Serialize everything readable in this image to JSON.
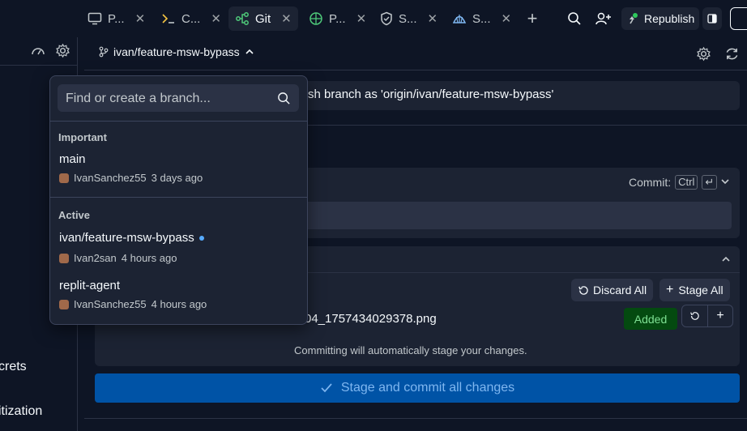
{
  "topbar": {
    "tabs": [
      {
        "label": "P...",
        "icon": "monitor-icon"
      },
      {
        "label": "C...",
        "icon": "terminal-icon"
      },
      {
        "label": "Git",
        "icon": "git-icon"
      },
      {
        "label": "P...",
        "icon": "globe-icon"
      },
      {
        "label": "S...",
        "icon": "shield-icon"
      },
      {
        "label": "S...",
        "icon": "shell-icon"
      }
    ],
    "republish_label": "Republish"
  },
  "sidebar": {
    "items": [
      "crets",
      "itization"
    ]
  },
  "git": {
    "branch": "ivan/feature-msw-bypass",
    "banner_text": "sh branch as 'origin/ivan/feature-msw-bypass'",
    "commit_label": "Commit:",
    "commit_key": "Ctrl",
    "discard_all": "Discard All",
    "stage_all": "Stage All",
    "file_name": "04_1757434029378.png",
    "file_status": "Added",
    "hint": "Committing will automatically stage your changes.",
    "commit_button": "Stage and commit all changes"
  },
  "dropdown": {
    "search_placeholder": "Find or create a branch...",
    "important_title": "Important",
    "important": [
      {
        "name": "main",
        "author": "IvanSanchez55",
        "time": "3 days ago"
      }
    ],
    "active_title": "Active",
    "active": [
      {
        "name": "ivan/feature-msw-bypass",
        "author": "Ivan2san",
        "time": "4 hours ago"
      },
      {
        "name": "replit-agent",
        "author": "IvanSanchez55",
        "time": "4 hours ago"
      }
    ]
  },
  "colors": {
    "background": "#0e1525",
    "surface": "#1c2333",
    "accent": "#0053a6",
    "added_bg": "#044a10"
  }
}
